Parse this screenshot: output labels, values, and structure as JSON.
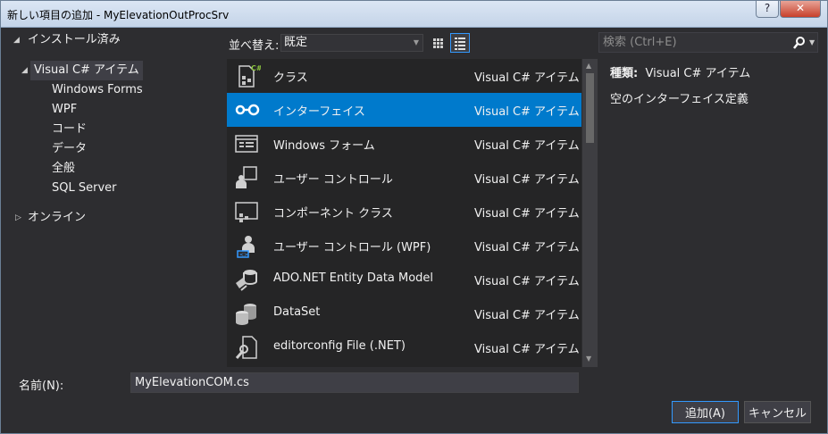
{
  "window": {
    "title": "新しい項目の追加 - MyElevationOutProcSrv",
    "help_label": "?",
    "close_label": "✕"
  },
  "tree": {
    "installed_label": "インストール済み",
    "visual_csharp_label": "Visual C# アイテム",
    "children": [
      "Windows Forms",
      "WPF",
      "コード",
      "データ",
      "全般",
      "SQL Server"
    ],
    "online_label": "オンライン"
  },
  "toolbar": {
    "sort_label": "並べ替え:",
    "sort_value": "既定"
  },
  "search": {
    "placeholder": "検索 (Ctrl+E)"
  },
  "items": [
    {
      "name": "クラス",
      "category": "Visual C# アイテム",
      "icon": "class-icon"
    },
    {
      "name": "インターフェイス",
      "category": "Visual C# アイテム",
      "icon": "interface-icon"
    },
    {
      "name": "Windows フォーム",
      "category": "Visual C# アイテム",
      "icon": "windows-form-icon"
    },
    {
      "name": "ユーザー コントロール",
      "category": "Visual C# アイテム",
      "icon": "user-control-icon"
    },
    {
      "name": "コンポーネント クラス",
      "category": "Visual C# アイテム",
      "icon": "component-class-icon"
    },
    {
      "name": "ユーザー コントロール (WPF)",
      "category": "Visual C# アイテム",
      "icon": "wpf-user-control-icon"
    },
    {
      "name": "ADO.NET Entity Data Model",
      "category": "Visual C# アイテム",
      "icon": "entity-data-model-icon"
    },
    {
      "name": "DataSet",
      "category": "Visual C# アイテム",
      "icon": "dataset-icon"
    },
    {
      "name": "editorconfig File (.NET)",
      "category": "Visual C# アイテム",
      "icon": "editorconfig-icon"
    }
  ],
  "selected_item_index": 1,
  "details": {
    "kind_label": "種類:",
    "kind_value": "Visual C# アイテム",
    "description": "空のインターフェイス定義"
  },
  "name_field": {
    "label": "名前(N):",
    "value": "MyElevationCOM.cs"
  },
  "buttons": {
    "add": "追加(A)",
    "cancel": "キャンセル"
  },
  "colors": {
    "selection": "#007acc",
    "background": "#2d2d30",
    "list_background": "#252526",
    "accent": "#3399ff"
  }
}
